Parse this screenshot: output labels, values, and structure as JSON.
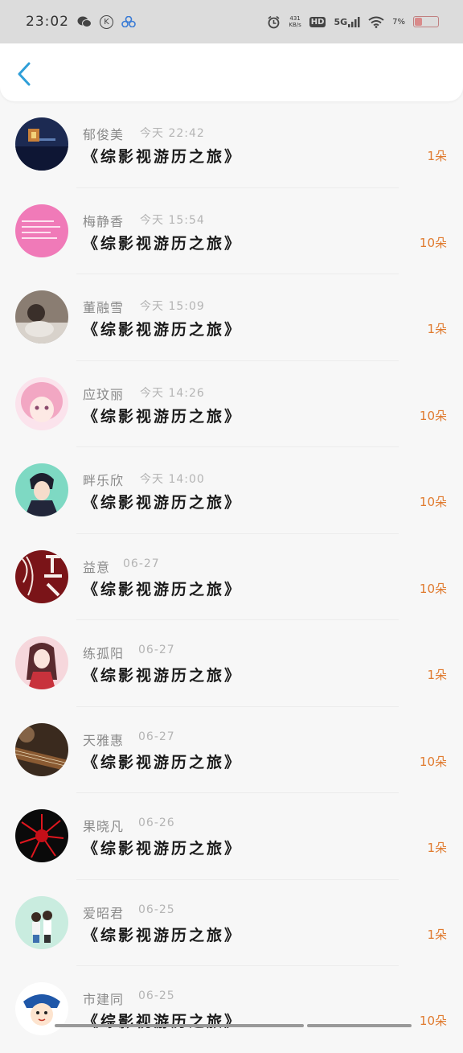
{
  "status_bar": {
    "time": "23:02",
    "net_speed_top": "431",
    "net_speed_bottom": "KB/s",
    "hd": "HD",
    "network": "5G",
    "battery": "7%"
  },
  "records": [
    {
      "name": "郁俊美",
      "time": "今天 22:42",
      "book": "《综影视游历之旅》",
      "amount": "1朵"
    },
    {
      "name": "梅静香",
      "time": "今天 15:54",
      "book": "《综影视游历之旅》",
      "amount": "10朵"
    },
    {
      "name": "董融雪",
      "time": "今天 15:09",
      "book": "《综影视游历之旅》",
      "amount": "1朵"
    },
    {
      "name": "应玟丽",
      "time": "今天 14:26",
      "book": "《综影视游历之旅》",
      "amount": "10朵"
    },
    {
      "name": "畔乐欣",
      "time": "今天 14:00",
      "book": "《综影视游历之旅》",
      "amount": "10朵"
    },
    {
      "name": "益意",
      "time": "06-27",
      "book": "《综影视游历之旅》",
      "amount": "10朵"
    },
    {
      "name": "练孤阳",
      "time": "06-27",
      "book": "《综影视游历之旅》",
      "amount": "1朵"
    },
    {
      "name": "天雅惠",
      "time": "06-27",
      "book": "《综影视游历之旅》",
      "amount": "10朵"
    },
    {
      "name": "果晓凡",
      "time": "06-26",
      "book": "《综影视游历之旅》",
      "amount": "1朵"
    },
    {
      "name": "爱昭君",
      "time": "06-25",
      "book": "《综影视游历之旅》",
      "amount": "1朵"
    },
    {
      "name": "市建同",
      "time": "06-25",
      "book": "《综影视游历之旅》",
      "amount": "10朵"
    }
  ],
  "colors": {
    "accent": "#2f9fd8",
    "amount": "#e07a2e",
    "name": "#8a8a8a",
    "time": "#b4b4b4",
    "book": "#1a1a1a"
  }
}
